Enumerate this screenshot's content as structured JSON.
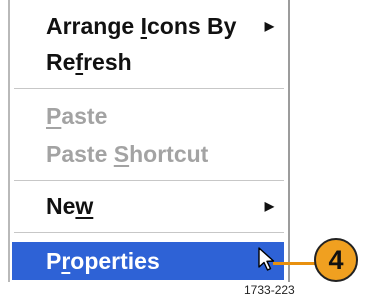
{
  "menu": {
    "items": [
      {
        "pre": "Arrange ",
        "acc": "I",
        "post": "cons By",
        "submenu": true,
        "disabled": false
      },
      {
        "pre": "Re",
        "acc": "f",
        "post": "resh",
        "submenu": false,
        "disabled": false
      },
      {
        "pre": "",
        "acc": "P",
        "post": "aste",
        "submenu": false,
        "disabled": true
      },
      {
        "pre": "Paste ",
        "acc": "S",
        "post": "hortcut",
        "submenu": false,
        "disabled": true
      },
      {
        "pre": "Ne",
        "acc": "w",
        "post": "",
        "submenu": true,
        "disabled": false
      },
      {
        "pre": "P",
        "acc": "r",
        "post": "operties",
        "submenu": false,
        "disabled": false,
        "highlighted": true
      }
    ],
    "submenu_glyph": "▶"
  },
  "callout": {
    "number": "4",
    "color": "#f0a020"
  },
  "figure_id": "1733-223",
  "colors": {
    "highlight": "#2e62d6",
    "disabled_text": "#a3a3a3",
    "connector": "#e8900e"
  }
}
